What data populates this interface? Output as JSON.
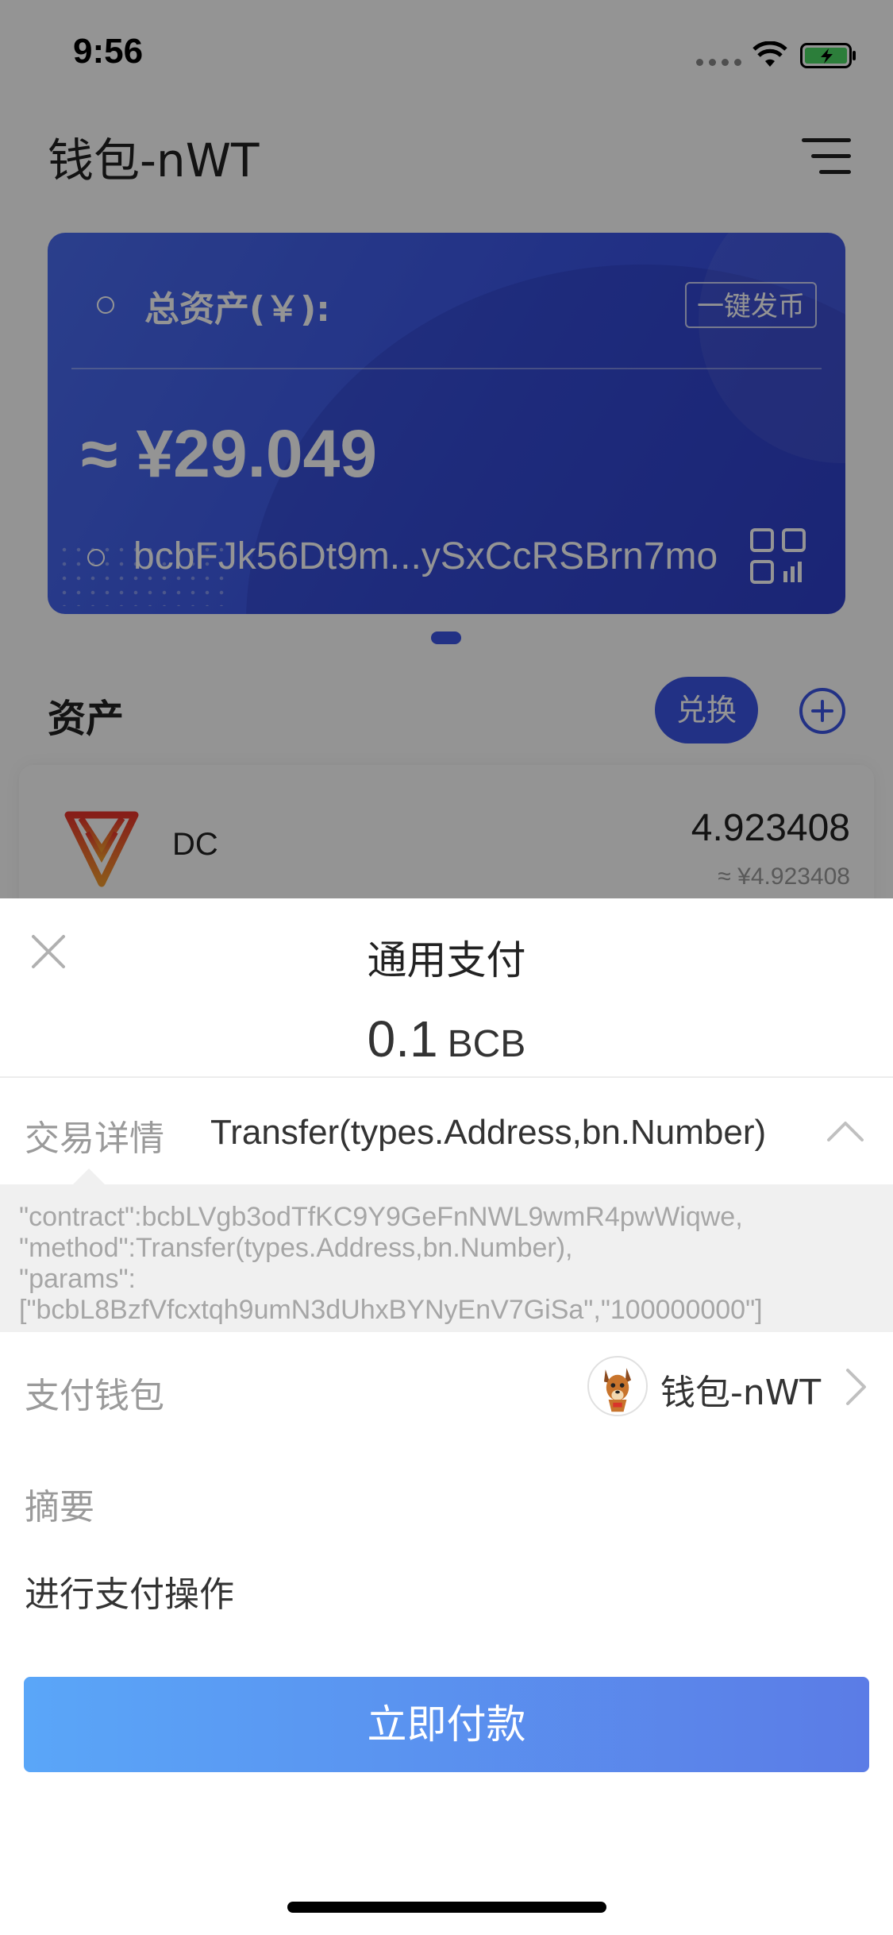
{
  "status_bar": {
    "time": "9:56"
  },
  "wallet_page": {
    "title": "钱包-nWT",
    "card": {
      "total_label": "总资产(￥):",
      "issue_button": "一键发币",
      "total_amount": "≈ ¥29.049",
      "address": "bcbFJk56Dt9m...ySxCcRSBrn7mo"
    },
    "assets_heading": "资产",
    "exchange_button": "兑换",
    "assets": [
      {
        "name": "DC",
        "amount": "4.923408",
        "value": "≈ ¥4.923408"
      }
    ]
  },
  "payment_sheet": {
    "title": "通用支付",
    "amount": "0.1",
    "currency": "BCB",
    "detail_label": "交易详情",
    "detail_method": "Transfer(types.Address,bn.Number)",
    "detail_lines": [
      "\"contract\":bcbLVgb3odTfKC9Y9GeFnNWL9wmR4pwWiqwe,",
      "\"method\":Transfer(types.Address,bn.Number),",
      "\"params\":",
      "[\"bcbL8BzfVfcxtqh9umN3dUhxBYNyEnV7GiSa\",\"100000000\"]"
    ],
    "wallet_label": "支付钱包",
    "wallet_name": "钱包-nWT",
    "memo_label": "摘要",
    "memo_text": "进行支付操作",
    "pay_button": "立即付款"
  },
  "colors": {
    "brand_blue": "#3b55e6",
    "pay_gradient_start": "#5aa6f8",
    "pay_gradient_end": "#5b7ce6",
    "overlay": "rgba(0,0,0,0.42)"
  },
  "icons": [
    "wifi-icon",
    "battery-icon",
    "menu-icon",
    "qr-code-icon",
    "add-circle-icon",
    "dc-token-logo",
    "close-icon",
    "chevron-up-icon",
    "wallet-avatar-icon",
    "chevron-right-icon"
  ]
}
